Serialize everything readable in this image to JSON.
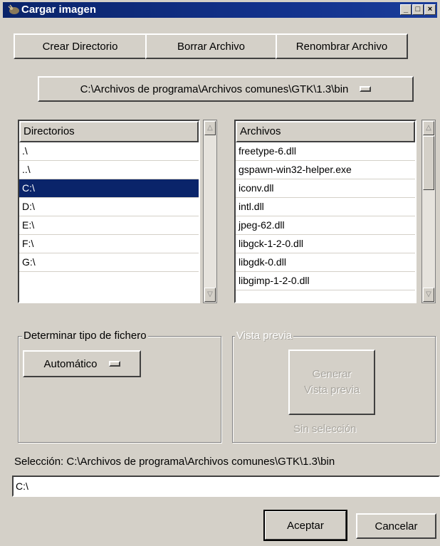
{
  "window": {
    "title": "Cargar imagen"
  },
  "toolbar": {
    "create_dir": "Crear Directorio",
    "delete_file": "Borrar Archivo",
    "rename_file": "Renombrar Archivo"
  },
  "path_selector": {
    "value": "C:\\Archivos de programa\\Archivos comunes\\GTK\\1.3\\bin"
  },
  "directories": {
    "header": "Directorios",
    "items": [
      ".\\",
      "..\\",
      "C:\\",
      "D:\\",
      "E:\\",
      "F:\\",
      "G:\\"
    ],
    "selected_index": 2
  },
  "files": {
    "header": "Archivos",
    "items": [
      "freetype-6.dll",
      "gspawn-win32-helper.exe",
      "iconv.dll",
      "intl.dll",
      "jpeg-62.dll",
      "libgck-1-2-0.dll",
      "libgdk-0.dll",
      "libgimp-1-2-0.dll"
    ]
  },
  "file_type": {
    "label": "Determinar tipo de fichero",
    "selected": "Automático"
  },
  "preview": {
    "label": "Vista previa",
    "generate_button": "Generar Vista previa",
    "generate_line1": "Generar",
    "generate_line2": "Vista previa",
    "status": "Sin selección"
  },
  "selection": {
    "label": "Selección: C:\\Archivos de programa\\Archivos comunes\\GTK\\1.3\\bin",
    "value": "C:\\"
  },
  "actions": {
    "ok": "Aceptar",
    "cancel": "Cancelar"
  },
  "colors": {
    "titlebar": "#0a246a",
    "selection": "#0a246a",
    "face": "#d4d0c8"
  }
}
